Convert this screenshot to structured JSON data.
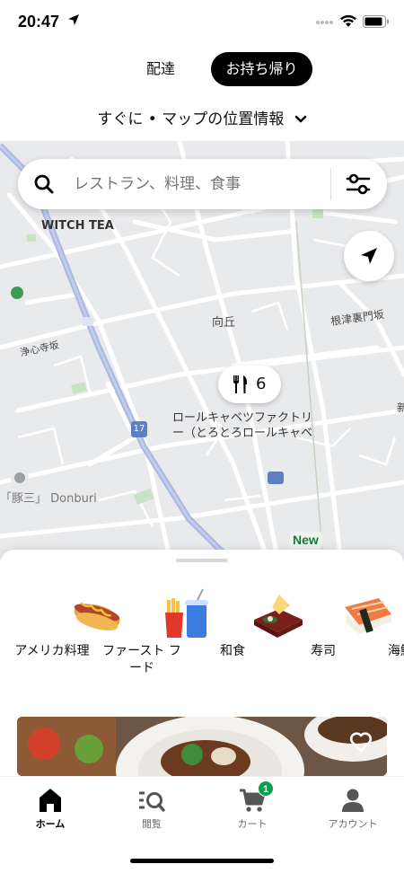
{
  "status_bar": {
    "time": "20:47"
  },
  "modes": {
    "delivery": "配達",
    "takeout": "お持ち帰り",
    "selected": "お持ち帰り"
  },
  "location": {
    "label": "すぐに • マップの位置情報"
  },
  "search": {
    "placeholder": "レストラン、料理、食事"
  },
  "map": {
    "labels": {
      "witch_tea": "WITCH TEA",
      "mukougaoka": "向丘",
      "nezu_uramon": "根津裏門坂",
      "joshinji": "浄心寺坂",
      "restaurant_line1": "ロールキャベツファクトリ",
      "restaurant_line2": "ー（とろとろロールキャベ",
      "donburi": "「豚三」 Donburi",
      "route": "17",
      "edge_char": "新"
    },
    "pin_count": "6",
    "new_badge": "New"
  },
  "categories": [
    {
      "label": "アメリカ料理",
      "icon": "hotdog-icon"
    },
    {
      "label": "ファースト フード",
      "icon": "fast-food-icon"
    },
    {
      "label": "和食",
      "icon": "japanese-food-icon"
    },
    {
      "label": "寿司",
      "icon": "sushi-icon"
    },
    {
      "label": "海鮮",
      "icon": "seafood-icon"
    }
  ],
  "tabs": [
    {
      "label": "ホーム",
      "icon": "home-icon",
      "active": true
    },
    {
      "label": "閲覧",
      "icon": "browse-icon",
      "active": false
    },
    {
      "label": "カート",
      "icon": "cart-icon",
      "active": false,
      "badge": "1"
    },
    {
      "label": "アカウント",
      "icon": "account-icon",
      "active": false
    }
  ],
  "colors": {
    "accent": "#000000",
    "badge_green": "#06a04a",
    "map_bg": "#e9eaec",
    "road": "#ffffff",
    "highway": "#a9b7de"
  }
}
